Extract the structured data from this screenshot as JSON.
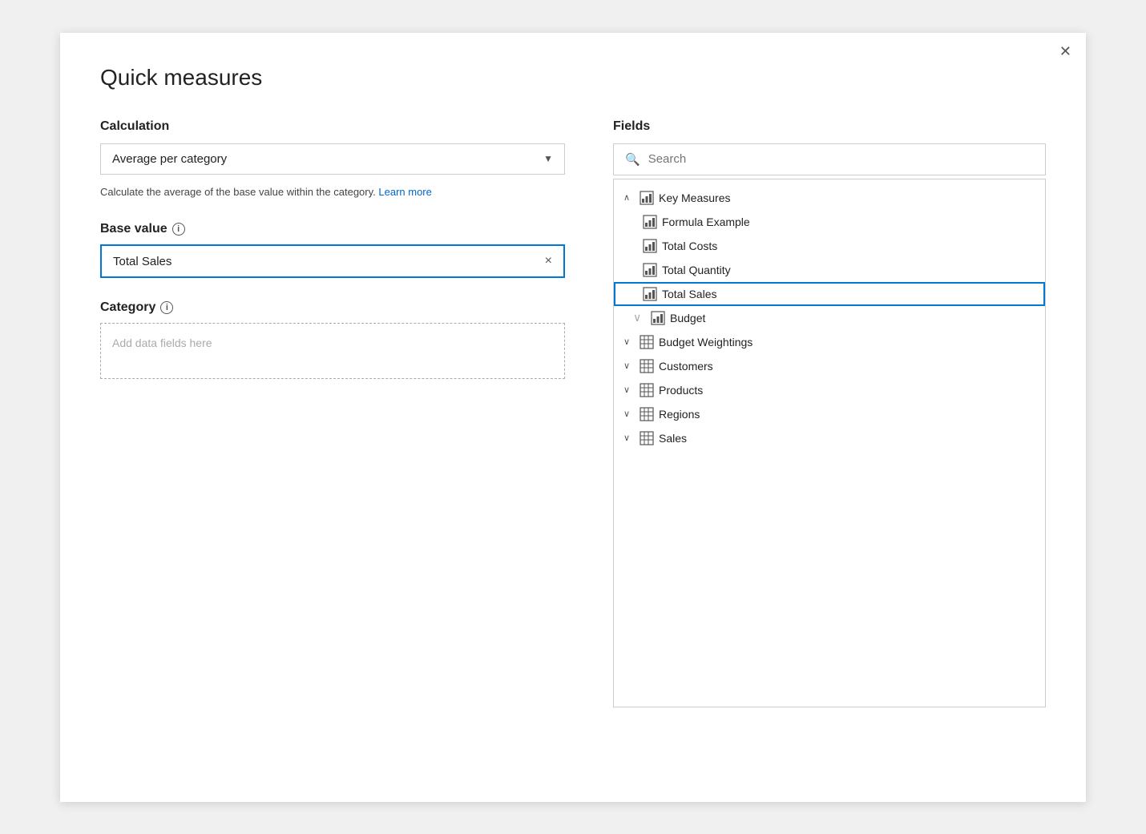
{
  "dialog": {
    "title": "Quick measures",
    "close_label": "✕"
  },
  "calculation": {
    "label": "Calculation",
    "selected": "Average per category",
    "description": "Calculate the average of the base value within the category.",
    "learn_more": "Learn more"
  },
  "base_value": {
    "label": "Base value",
    "value": "Total Sales",
    "clear_symbol": "×"
  },
  "category": {
    "label": "Category",
    "placeholder": "Add data fields here"
  },
  "fields": {
    "label": "Fields",
    "search_placeholder": "Search",
    "tree": [
      {
        "id": "key-measures",
        "type": "parent",
        "expanded": true,
        "label": "Key Measures",
        "icon": "measure"
      },
      {
        "id": "formula-example",
        "type": "child",
        "label": "Formula Example",
        "icon": "measure"
      },
      {
        "id": "total-costs",
        "type": "child",
        "label": "Total Costs",
        "icon": "measure"
      },
      {
        "id": "total-quantity",
        "type": "child",
        "label": "Total Quantity",
        "icon": "measure"
      },
      {
        "id": "total-sales",
        "type": "child",
        "label": "Total Sales",
        "icon": "measure",
        "highlighted": true
      },
      {
        "id": "budget",
        "type": "child-table",
        "label": "Budget",
        "icon": "measure",
        "hasChevron": true
      },
      {
        "id": "budget-weightings",
        "type": "parent",
        "expanded": false,
        "label": "Budget Weightings",
        "icon": "table"
      },
      {
        "id": "customers",
        "type": "parent",
        "expanded": false,
        "label": "Customers",
        "icon": "table"
      },
      {
        "id": "products",
        "type": "parent",
        "expanded": false,
        "label": "Products",
        "icon": "table"
      },
      {
        "id": "regions",
        "type": "parent",
        "expanded": false,
        "label": "Regions",
        "icon": "table"
      },
      {
        "id": "sales",
        "type": "parent",
        "expanded": false,
        "label": "Sales",
        "icon": "table"
      }
    ]
  }
}
